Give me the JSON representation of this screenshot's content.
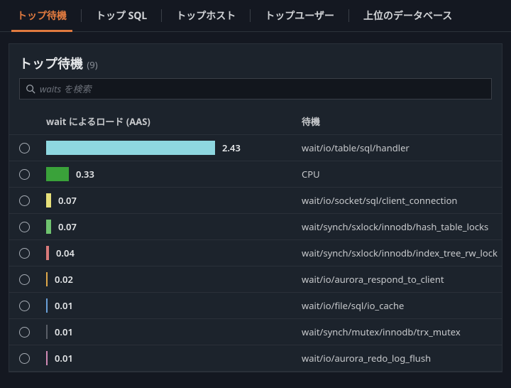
{
  "tabs": {
    "items": [
      {
        "label": "トップ待機",
        "active": true
      },
      {
        "label": "トップ SQL",
        "active": false
      },
      {
        "label": "トップホスト",
        "active": false
      },
      {
        "label": "トップユーザー",
        "active": false
      },
      {
        "label": "上位のデータベース",
        "active": false
      }
    ]
  },
  "panel": {
    "title": "トップ待機",
    "count": "(9)"
  },
  "search": {
    "placeholder": "waits を検索"
  },
  "columns": {
    "load": "wait によるロード (AAS)",
    "wait": "待機"
  },
  "bar": {
    "max": 2.43,
    "maxWidthPx": 238
  },
  "rows": [
    {
      "value": 2.43,
      "label": "wait/io/table/sql/handler",
      "color": "#8ed7e0"
    },
    {
      "value": 0.33,
      "label": "CPU",
      "color": "#3aa23a"
    },
    {
      "value": 0.07,
      "label": "wait/io/socket/sql/client_connection",
      "color": "#e6e07a"
    },
    {
      "value": 0.07,
      "label": "wait/synch/sxlock/innodb/hash_table_locks",
      "color": "#6fc36f"
    },
    {
      "value": 0.04,
      "label": "wait/synch/sxlock/innodb/index_tree_rw_lock",
      "color": "#d97a7a"
    },
    {
      "value": 0.02,
      "label": "wait/io/aurora_respond_to_client",
      "color": "#e0a84a"
    },
    {
      "value": 0.01,
      "label": "wait/io/file/sql/io_cache",
      "color": "#6aa0d8"
    },
    {
      "value": 0.01,
      "label": "wait/synch/mutex/innodb/trx_mutex",
      "color": "#5a5f68"
    },
    {
      "value": 0.01,
      "label": "wait/io/aurora_redo_log_flush",
      "color": "#d08ab5"
    }
  ]
}
